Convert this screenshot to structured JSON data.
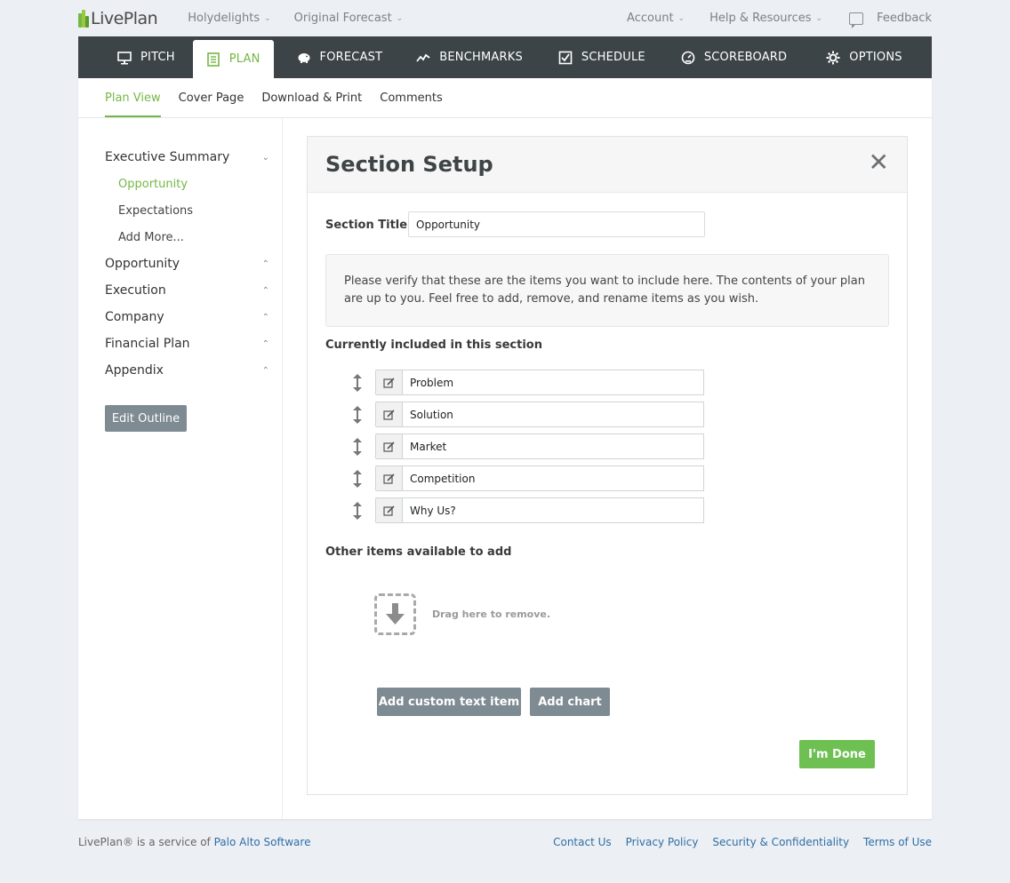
{
  "topbar": {
    "logo_text": "LivePlan",
    "company_menu": "Holydelights",
    "forecast_menu": "Original Forecast",
    "account": "Account",
    "help": "Help & Resources",
    "feedback": "Feedback",
    "brand_color": "#74b843"
  },
  "mainnav": {
    "tabs": [
      {
        "label": "PITCH",
        "icon": "monitor-icon"
      },
      {
        "label": "PLAN",
        "icon": "notebook-icon"
      },
      {
        "label": "FORECAST",
        "icon": "piggy-bank-icon"
      },
      {
        "label": "BENCHMARKS",
        "icon": "trend-icon"
      },
      {
        "label": "SCHEDULE",
        "icon": "checkbox-icon"
      },
      {
        "label": "SCOREBOARD",
        "icon": "gauge-icon"
      },
      {
        "label": "OPTIONS",
        "icon": "gear-icon"
      }
    ],
    "active_tab": "PLAN"
  },
  "subnav": {
    "tabs": [
      "Plan View",
      "Cover Page",
      "Download & Print",
      "Comments"
    ],
    "active": "Plan View"
  },
  "sidebar": {
    "sections": [
      "Executive Summary",
      "Opportunity",
      "Execution",
      "Company",
      "Financial Plan",
      "Appendix"
    ],
    "exec_items": [
      "Opportunity",
      "Expectations",
      "Add More..."
    ],
    "edit_outline": "Edit Outline"
  },
  "dialog": {
    "title": "Section Setup",
    "section_title_label": "Section Title:",
    "section_title_value": "Opportunity",
    "notice": "Please verify that these are the items you want to include here. The contents of your plan are up to you. Feel free to add, remove, and rename items as you wish.",
    "included_heading": "Currently included in this section",
    "items": [
      "Problem",
      "Solution",
      "Market",
      "Competition",
      "Why Us?"
    ],
    "other_heading": "Other items available to add",
    "drop_text": "Drag here to remove.",
    "add_custom": "Add custom text item",
    "add_chart": "Add chart",
    "done": "I'm Done"
  },
  "footer": {
    "service_prefix": "LivePlan® is a service of",
    "service_link": "Palo Alto Software",
    "links": [
      "Contact Us",
      "Privacy Policy",
      "Security & Confidentiality",
      "Terms of Use"
    ]
  }
}
